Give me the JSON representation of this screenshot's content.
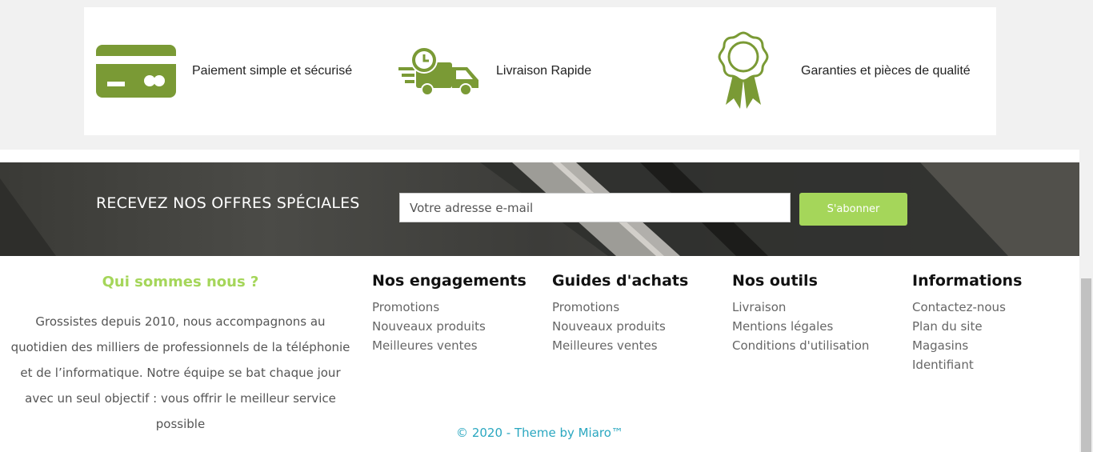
{
  "features": [
    {
      "icon": "credit-card-icon",
      "label": "Paiement simple et sécurisé"
    },
    {
      "icon": "delivery-truck-icon",
      "label": "Livraison Rapide"
    },
    {
      "icon": "quality-badge-icon",
      "label": "Garanties et pièces de qualité"
    }
  ],
  "newsletter": {
    "title": "RECEVEZ NOS OFFRES SPÉCIALES",
    "placeholder": "Votre adresse e-mail",
    "button": "S'abonner"
  },
  "about": {
    "title": "Qui sommes nous ?",
    "text": "Grossistes depuis 2010, nous accompagnons au quotidien des milliers de professionnels de la téléphonie et de l’informatique. Notre équipe se bat chaque jour avec un seul objectif : vous offrir le meilleur service possible"
  },
  "columns": [
    {
      "title": "Nos engagements",
      "links": [
        "Promotions",
        "Nouveaux produits",
        "Meilleures ventes"
      ]
    },
    {
      "title": "Guides d'achats",
      "links": [
        "Promotions",
        "Nouveaux produits",
        "Meilleures ventes"
      ]
    },
    {
      "title": "Nos outils",
      "links": [
        "Livraison",
        "Mentions légales",
        "Conditions d'utilisation"
      ]
    },
    {
      "title": "Informations",
      "links": [
        "Contactez-nous",
        "Plan du site",
        "Magasins",
        "Identifiant"
      ]
    }
  ],
  "copyright": "© 2020 - Theme by Miaro™",
  "colors": {
    "accent": "#a5d65a",
    "icon_green": "#7a9a35",
    "copyright": "#2aa7c0"
  }
}
